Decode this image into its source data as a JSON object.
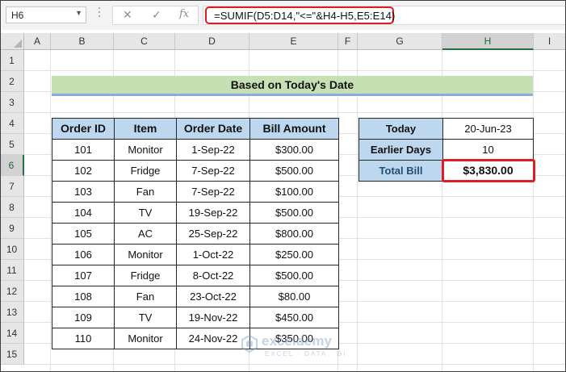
{
  "formula_bar": {
    "name_box": "H6",
    "cancel_icon": "✕",
    "enter_icon": "✓",
    "fx_icon": "fx",
    "formula": "=SUMIF(D5:D14,\"<=\"&H4-H5,E5:E14)"
  },
  "columns": [
    "A",
    "B",
    "C",
    "D",
    "E",
    "F",
    "G",
    "H",
    "I"
  ],
  "rows": [
    "1",
    "2",
    "3",
    "4",
    "5",
    "6",
    "7",
    "8",
    "9",
    "10",
    "11",
    "12",
    "13",
    "14",
    "15"
  ],
  "selected_column": "H",
  "selected_row": "6",
  "title": "Based on Today's Date",
  "orders": {
    "headers": [
      "Order ID",
      "Item",
      "Order Date",
      "Bill Amount"
    ],
    "rows": [
      [
        "101",
        "Monitor",
        "1-Sep-22",
        "$300.00"
      ],
      [
        "102",
        "Fridge",
        "7-Sep-22",
        "$500.00"
      ],
      [
        "103",
        "Fan",
        "7-Sep-22",
        "$100.00"
      ],
      [
        "104",
        "TV",
        "19-Sep-22",
        "$500.00"
      ],
      [
        "105",
        "AC",
        "25-Sep-22",
        "$800.00"
      ],
      [
        "106",
        "Monitor",
        "1-Oct-22",
        "$250.00"
      ],
      [
        "107",
        "Fridge",
        "8-Oct-22",
        "$500.00"
      ],
      [
        "108",
        "Fan",
        "23-Oct-22",
        "$80.00"
      ],
      [
        "109",
        "TV",
        "19-Nov-22",
        "$450.00"
      ],
      [
        "110",
        "Monitor",
        "24-Nov-22",
        "$350.00"
      ]
    ]
  },
  "summary": {
    "today_label": "Today",
    "today_value": "20-Jun-23",
    "earlier_label": "Earlier Days",
    "earlier_value": "10",
    "total_label": "Total Bill",
    "total_value": "$3,830.00"
  },
  "watermark": {
    "name": "exceldemy",
    "tagline": "EXCEL · DATA · BI"
  },
  "colors": {
    "accent_red": "#dd1c24",
    "header_blue": "#bdd7ee",
    "title_green": "#c6e0b4",
    "excel_green": "#217346"
  }
}
